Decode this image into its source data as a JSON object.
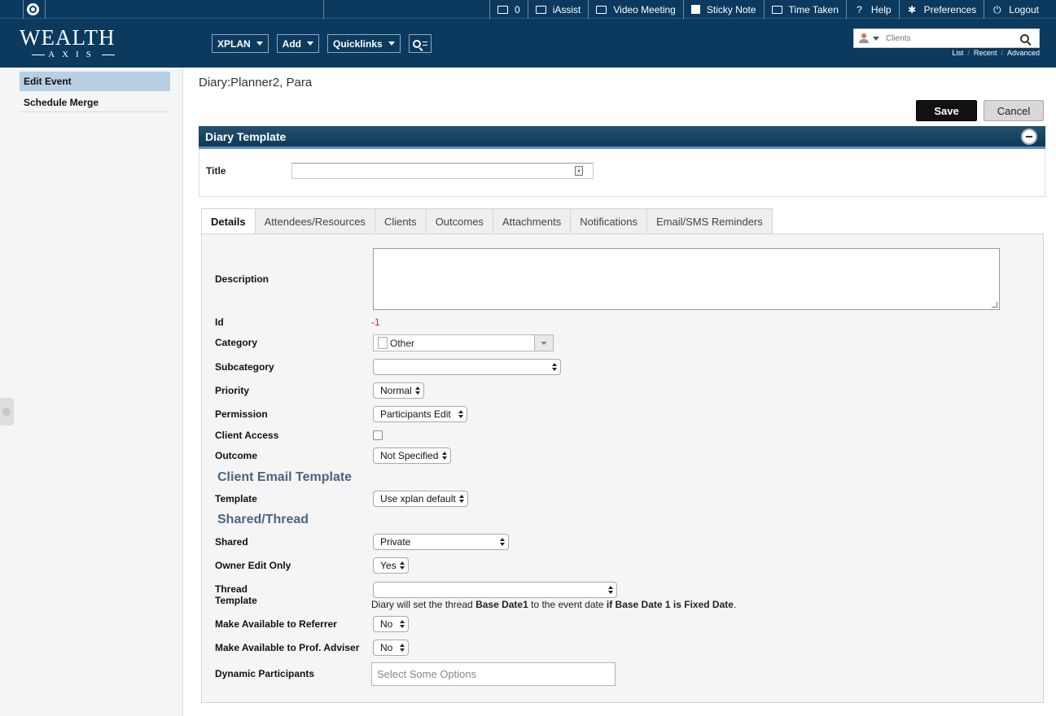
{
  "topbar": {
    "items": [
      {
        "icon": "envelope-icon",
        "label": "0"
      },
      {
        "icon": "iassist-icon",
        "label": "iAssist"
      },
      {
        "icon": "video-meeting-icon",
        "label": "Video Meeting"
      },
      {
        "icon": "sticky-note-icon",
        "label": "Sticky Note"
      },
      {
        "icon": "clock-icon",
        "label": "Time Taken"
      },
      {
        "icon": "question-icon",
        "label": "Help"
      },
      {
        "icon": "gear-icon",
        "label": "Preferences"
      },
      {
        "icon": "power-icon",
        "label": "Logout"
      }
    ]
  },
  "header": {
    "logo_line1": "WEALTH",
    "logo_line2": "AXIS",
    "nav": {
      "xplan": "XPLAN",
      "add": "Add",
      "quicklinks": "Quicklinks"
    },
    "search": {
      "placeholder": "Clients"
    },
    "search_links": {
      "list": "List",
      "recent": "Recent",
      "advanced": "Advanced"
    }
  },
  "sidebar": {
    "items": [
      {
        "label": "Edit Event",
        "active": true
      },
      {
        "label": "Schedule Merge",
        "active": false
      }
    ]
  },
  "main": {
    "page_title": "Diary:Planner2, Para",
    "save_label": "Save",
    "cancel_label": "Cancel",
    "panel_title": "Diary Template",
    "title_label": "Title",
    "title_value": ""
  },
  "tabs": [
    "Details",
    "Attendees/Resources",
    "Clients",
    "Outcomes",
    "Attachments",
    "Notifications",
    "Email/SMS Reminders"
  ],
  "details": {
    "description_label": "Description",
    "description_value": "",
    "id_label": "Id",
    "id_value": "-1",
    "category_label": "Category",
    "category_value": "Other",
    "subcategory_label": "Subcategory",
    "subcategory_value": "",
    "priority_label": "Priority",
    "priority_value": "Normal",
    "permission_label": "Permission",
    "permission_value": "Participants Edit",
    "client_access_label": "Client Access",
    "client_access_checked": false,
    "outcome_label": "Outcome",
    "outcome_value": "Not Specified",
    "client_email_section": "Client Email Template",
    "template_label": "Template",
    "template_value": "Use xplan default",
    "shared_section": "Shared/Thread",
    "shared_label": "Shared",
    "shared_value": "Private",
    "owner_edit_label": "Owner Edit Only",
    "owner_edit_value": "Yes",
    "thread_label_1": "Thread",
    "thread_label_2": "Template",
    "thread_value": "",
    "thread_note_1": "Diary will set the thread ",
    "thread_note_b1": "Base Date1",
    "thread_note_2": " to the event date ",
    "thread_note_b2": "if Base Date 1 is Fixed Date",
    "thread_note_3": ".",
    "referrer_label": "Make Available to Referrer",
    "referrer_value": "No",
    "prof_adviser_label": "Make Available to Prof. Adviser",
    "prof_adviser_value": "No",
    "dynamic_label": "Dynamic Participants",
    "dynamic_placeholder": "Select Some Options"
  }
}
